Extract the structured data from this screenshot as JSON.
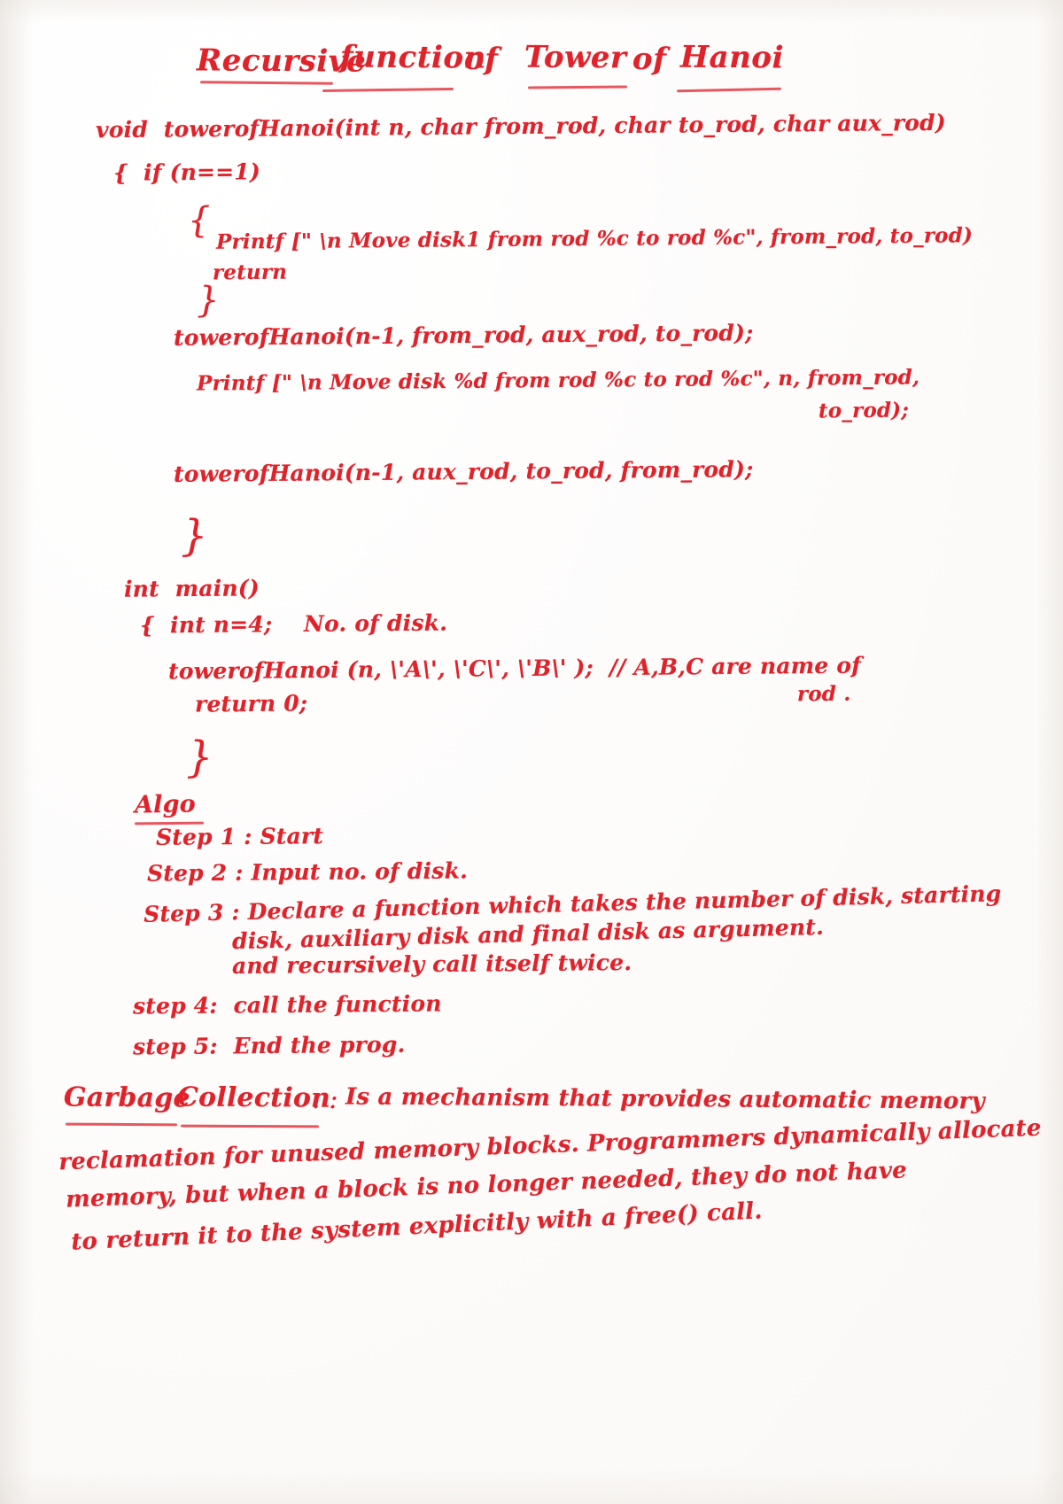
{
  "document": {
    "kind": "handwritten-notes",
    "ink_color": "#e0232b",
    "paper_color": "#fdfcfb",
    "title": "Recursive function of  Tower of Hanoi"
  },
  "title_parts": {
    "part1": "Recursive",
    "part2": "function",
    "part3": "of",
    "part4": "Tower",
    "part5": "of",
    "part6": "Hanoi"
  },
  "code": {
    "lines": [
      {
        "id": "l1",
        "text": "void  towerofHanoi(int n, char from_rod, char to_rod, char aux_rod)"
      },
      {
        "id": "l2",
        "text": "{  if (n==1)"
      },
      {
        "id": "l3",
        "text": "{"
      },
      {
        "id": "l4",
        "text": "Printf [\" \\n Move disk1 from rod %c to rod %c\", from_rod, to_rod)"
      },
      {
        "id": "l5",
        "text": "return"
      },
      {
        "id": "l6",
        "text": "}"
      },
      {
        "id": "l7",
        "text": "towerofHanoi(n-1, from_rod, aux_rod, to_rod);"
      },
      {
        "id": "l8",
        "text": "Printf [\" \\n Move disk %d from rod %c to rod %c\", n, from_rod,"
      },
      {
        "id": "l9",
        "text": "to_rod);"
      },
      {
        "id": "l10",
        "text": "towerofHanoi(n-1, aux_rod, to_rod, from_rod);"
      },
      {
        "id": "l11",
        "text": "}"
      },
      {
        "id": "l12",
        "text": "int  main()"
      },
      {
        "id": "l13",
        "text": "{  int n=4;    No. of disk."
      },
      {
        "id": "l14",
        "text": "towerofHanoi (n, \\'A\\', \\'C\\', \\'B\\' );  // A,B,C are name of"
      },
      {
        "id": "l15",
        "text": "rod ."
      },
      {
        "id": "l16",
        "text": "return 0;"
      },
      {
        "id": "l17",
        "text": "}"
      }
    ]
  },
  "algo": {
    "heading": "Algo",
    "steps": [
      {
        "label": "Step 1 :",
        "text": "Start"
      },
      {
        "label": "Step 2 :",
        "text": "Input no. of disk."
      },
      {
        "label": "Step 3 :",
        "text": "Declare a function which takes the number of disk, starting"
      },
      {
        "label": "",
        "text": "disk, auxiliary disk and final disk as argument."
      },
      {
        "label": "",
        "text": "and recursively call itself twice."
      },
      {
        "label": "step 4:",
        "text": "call the function"
      },
      {
        "label": "step 5:",
        "text": "End the prog."
      }
    ]
  },
  "garbage_collection": {
    "heading_part1": "Garbage",
    "heading_part2": "Collection",
    "heading_suffix": ". :",
    "lines": [
      "Is a mechanism that provides automatic memory",
      "reclamation for unused memory blocks. Programmers dynamically allocate",
      "memory, but when a block is no longer needed, they do not have",
      "to return it to the system explicitly with a free() call."
    ]
  }
}
